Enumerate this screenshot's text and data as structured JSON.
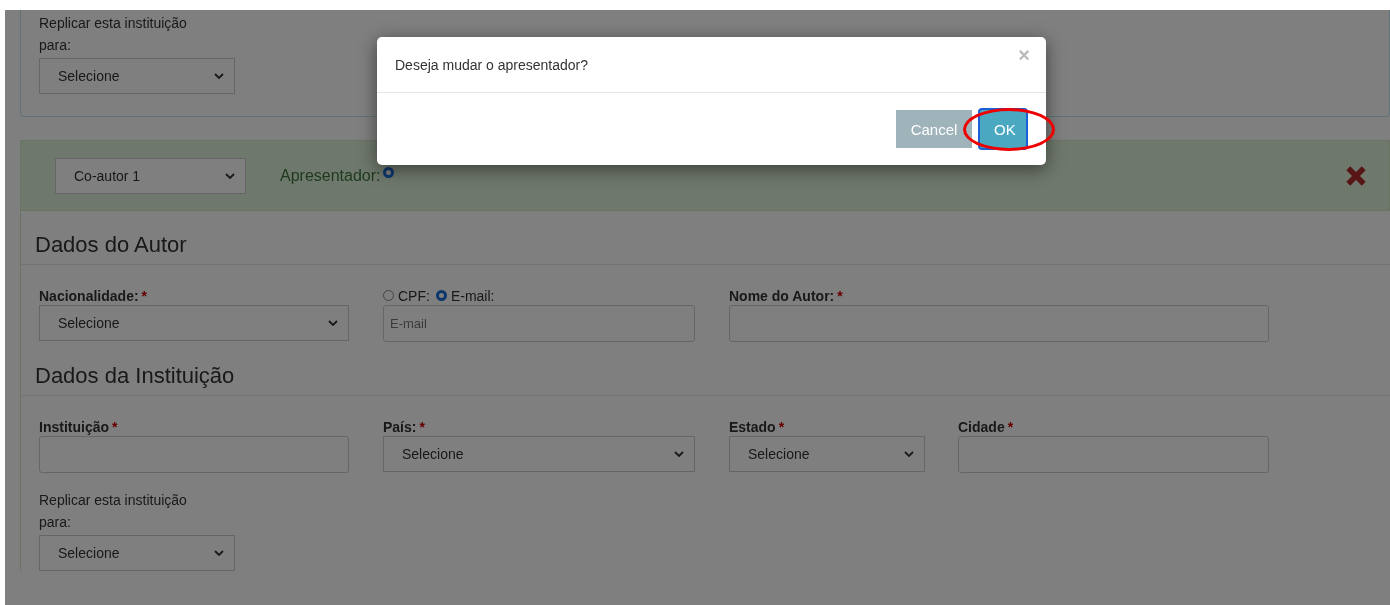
{
  "top_panel": {
    "replicate_label": "Replicar esta instituição para:",
    "select_value": "Selecione"
  },
  "coauthor": {
    "select_value": "Co-autor 1",
    "presenter_label": "Apresentador:",
    "presenter_selected": true
  },
  "sections": [
    {
      "title": "Dados do Autor",
      "fields": [
        {
          "kind": "select",
          "label": "Nacionalidade:",
          "required_mark": "*",
          "value": "Selecione"
        },
        {
          "kind": "id_choice",
          "options": [
            {
              "label": "CPF:",
              "selected": false
            },
            {
              "label": "E-mail:",
              "selected": true
            }
          ],
          "placeholder": "E-mail"
        },
        {
          "kind": "input",
          "label": "Nome do Autor:",
          "required_mark": "*"
        }
      ]
    },
    {
      "title": "Dados da Instituição",
      "fields": [
        {
          "kind": "input",
          "label": "Instituição",
          "required_mark": "*"
        },
        {
          "kind": "select",
          "label": "País:",
          "required_mark": "*",
          "value": "Selecione"
        },
        {
          "kind": "select",
          "label": "Estado",
          "required_mark": "*",
          "value": "Selecione"
        },
        {
          "kind": "input",
          "label": "Cidade",
          "required_mark": "*"
        }
      ],
      "replicate": {
        "label": "Replicar esta instituição para:",
        "select_value": "Selecione"
      }
    }
  ],
  "dialog": {
    "message": "Deseja mudar o apresentador?",
    "close": "×",
    "buttons": [
      {
        "label": "Cancel",
        "kind": "secondary"
      },
      {
        "label": "OK",
        "kind": "primary"
      }
    ]
  }
}
